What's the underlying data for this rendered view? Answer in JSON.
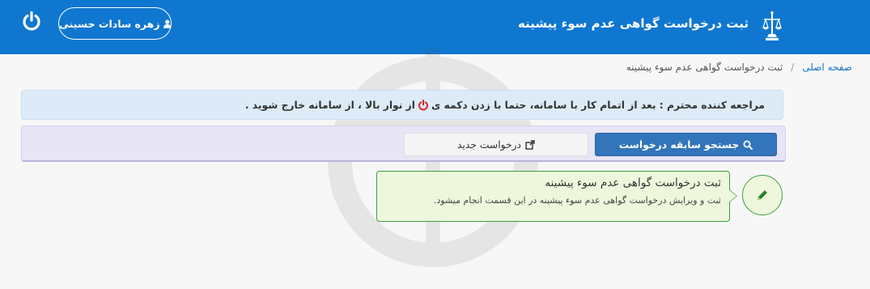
{
  "header": {
    "app_title": "ثبت درخواست گواهی عدم سوء پیشینه",
    "user_name": "زهره سادات حسینی",
    "emblem_icon": "judiciary-scales-emblem-icon",
    "power_icon": "power-icon",
    "user_icon": "user-icon",
    "background_color": "#0f77d0"
  },
  "breadcrumb": {
    "home": "صفحه اصلی",
    "separator": "/",
    "current": "ثبت درخواست گواهی عدم سوء پیشینه"
  },
  "alert": {
    "part1": "مراجعه کننده محترم : بعد از اتمام کار با سامانه، حتما با زدن دکمه ی",
    "part2": "از نوار بالا ، از سامانه خارج شوید ."
  },
  "toolbar": {
    "search_label": "جستجو سابقه درخواست",
    "new_label": "درخواست جدید",
    "search_icon": "search-icon",
    "new_icon": "external-link-icon"
  },
  "info_card": {
    "title": "ثبت درخواست گواهی عدم سوء پیشینه",
    "description": "ثبت و ویرایش درخواست گواهی عدم سوء پیشینه در این قسمت انجام میشود.",
    "icon": "pencil-icon",
    "accent_color": "#3f9e3f"
  }
}
